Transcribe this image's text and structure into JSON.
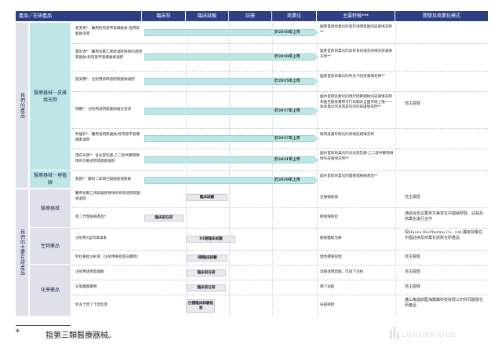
{
  "headers": {
    "category": "產品／在研產品",
    "preclinical": "臨床前",
    "clinical": "臨床試驗",
    "registration": "註冊",
    "commercialization": "商業化",
    "features": "主要特徵***",
    "model": "開發及商業化模式"
  },
  "groups": {
    "marketed": "我們的產品",
    "pipeline": "我們的主要在研產品"
  },
  "categories": {
    "derma_filler": "醫療器械－皮膚填充劑",
    "thread": "醫療器械－埋植線",
    "device": "醫療器械",
    "bio": "生物藥品",
    "chem": "化學藥品"
  },
  "rows": [
    {
      "product": "愛芙莱*：醫用羥丙基甲基纖維素-透明質酸鈉溶液",
      "bar": "於2016年上市",
      "feature": "國產首款商業化的基於透明質酸的皮膚填充劑**"
    },
    {
      "product": "寶尼達*：醫用含聚乙烯醇凝膠微球的透明質酸鈉-羥丙基甲基纖維素凝膠",
      "bar": "於2016年上市",
      "feature": "國產首款商業化的具有長效填充效果的皮膚填充劑**"
    },
    {
      "product": "愛美飄*：注射用修飾透明質酸鈉凝膠",
      "bar": "於2015年上市",
      "feature": "國產首款商業化的利多卡因皮膚填充劑**"
    },
    {
      "product": "嗨體*：注射用透明質酸鈉複合溶液",
      "bar": "於2017年上市",
      "feature": "國內首款商業化的用於修飾頸紋的皮膚填充劑和截至最後實際可行日期的全國市場上唯一一款商業化的具有該功效的皮膚填充劑**"
    },
    {
      "product": "熊貓針*：醫用透明質酸鈉-羥丙基甲基纖維素凝膠",
      "bar": "於2017年上市",
      "feature": "眼周皮膚年輕化的高端皮膚填充劑"
    },
    {
      "product": "濡白天使*：含左旋乳酸-乙二醇共聚物微球的交聯透明質酸鈉凝膠",
      "bar": "於2021年上市",
      "feature": "國內首款商業化的含左旋乳酸-乙二醇共聚物微球的皮膚填充劑**"
    },
    {
      "product": "緊顏*：聚對二氧環已酮面部埋植線",
      "bar": "於2019年上市",
      "feature": "國內首款商業化的面部埋植線產品**"
    },
    {
      "product": "醫用含聚乙烯醇凝膠微球的修飾透明質酸鈉凝膠",
      "badge": "臨床試驗",
      "feature": "治療頸後撓",
      "model": "自主開發"
    },
    {
      "product": "第二代埋植線產品*",
      "badge": "臨床前在研",
      "feature": "軟組織提拉",
      "model": "通過合資企業來方美容在中國就研發、註冊及商業化進行合作"
    },
    {
      "product": "注射用A型肉毒毒素",
      "badge": "III期臨床試驗",
      "feature": "動態皺紋治療",
      "model": "與Huons BioPharma Co., Ltd.獨家授權在中國註冊及商業化該款在研產品"
    },
    {
      "product": "利拉魯肽注射液（注射用重組蛋白藥物）",
      "badge": "I期臨床試驗",
      "feature": "慢性體重管理",
      "model": "自主開發"
    },
    {
      "product": "注射用透明質酸酶",
      "badge": "臨床前在研",
      "feature": "溶解透明質酸，可皮下注射",
      "model": "自主開發"
    },
    {
      "product": "去氧膽酸藥物",
      "badge": "臨床前在研",
      "feature": "頰下減脂",
      "model": "自主開發"
    },
    {
      "product": "利多卡因丁卡因乳膏",
      "badge": "已獲臨床試驗批准",
      "feature": "局部麻醉",
      "model": "攜山東誠創藍海醫藥科技有限公司共同開發在研產品"
    }
  ],
  "marketed_model": "自主開發",
  "footnote": {
    "mark": "*",
    "text": "指第三類醫療器械。"
  },
  "logo": "LONGBRIDGE",
  "colors": {
    "header": "#2e3f85",
    "category": "#bfe6e6",
    "group": "#dfe1ea",
    "bar": "#bfe6e6"
  }
}
